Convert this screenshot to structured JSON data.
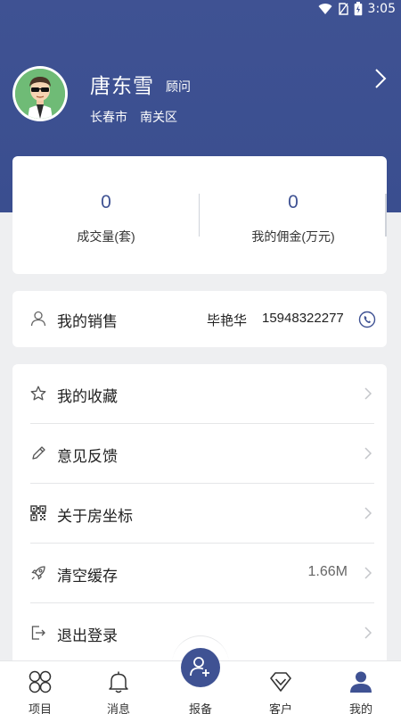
{
  "status_bar": {
    "time": "3:05"
  },
  "profile": {
    "name": "唐东雪",
    "role": "顾问",
    "city": "长春市",
    "district": "南关区"
  },
  "stats": [
    {
      "value": "0",
      "label": "成交量(套)"
    },
    {
      "value": "0",
      "label": "我的佣金(万元)"
    }
  ],
  "sales": {
    "label": "我的销售",
    "name": "毕艳华",
    "phone": "15948322277"
  },
  "menu": {
    "favorites": "我的收藏",
    "feedback": "意见反馈",
    "about": "关于房坐标",
    "clear_cache": "清空缓存",
    "cache_size": "1.66M",
    "logout": "退出登录"
  },
  "tabs": [
    {
      "label": "项目",
      "icon": "grid-icon"
    },
    {
      "label": "消息",
      "icon": "bell-icon"
    },
    {
      "label": "报备",
      "icon": "add-user-icon"
    },
    {
      "label": "客户",
      "icon": "diamond-icon"
    },
    {
      "label": "我的",
      "icon": "person-icon"
    }
  ],
  "colors": {
    "primary": "#3f5293",
    "background": "#eeeff1"
  }
}
